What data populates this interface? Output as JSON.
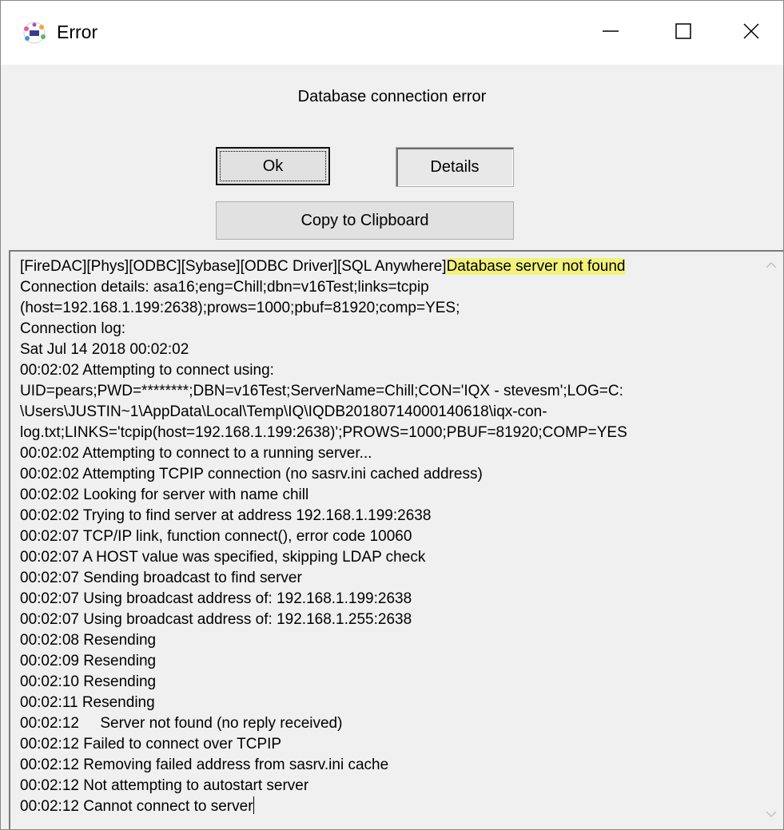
{
  "window": {
    "title": "Error",
    "icon": "iqx-app-icon"
  },
  "titlebar_buttons": {
    "minimize_icon": "minimize-icon",
    "maximize_icon": "maximize-icon",
    "close_icon": "close-icon"
  },
  "dialog": {
    "message": "Database connection error",
    "ok_label": "Ok",
    "details_label": "Details",
    "copy_label": "Copy to Clipboard"
  },
  "details": {
    "first_line_prefix": "[FireDAC][Phys][ODBC][Sybase][ODBC Driver][SQL Anywhere]",
    "first_line_highlight": "Database server not found",
    "highlight_color": "#f2f27a",
    "lines": [
      "Connection details: asa16;eng=Chill;dbn=v16Test;links=tcpip",
      "(host=192.168.1.199:2638);prows=1000;pbuf=81920;comp=YES;",
      "Connection log:",
      "Sat Jul 14 2018 00:02:02",
      "00:02:02 Attempting to connect using:",
      "UID=pears;PWD=********;DBN=v16Test;ServerName=Chill;CON='IQX - stevesm';LOG=C:",
      "\\Users\\JUSTIN~1\\AppData\\Local\\Temp\\IQ\\IQDB20180714000140618\\iqx-con-",
      "log.txt;LINKS='tcpip(host=192.168.1.199:2638)';PROWS=1000;PBUF=81920;COMP=YES",
      "00:02:02 Attempting to connect to a running server...",
      "00:02:02 Attempting TCPIP connection (no sasrv.ini cached address)",
      "00:02:02 Looking for server with name chill",
      "00:02:02 Trying to find server at address 192.168.1.199:2638",
      "00:02:07 TCP/IP link, function connect(), error code 10060",
      "00:02:07 A HOST value was specified, skipping LDAP check",
      "00:02:07 Sending broadcast to find server",
      "00:02:07 Using broadcast address of: 192.168.1.199:2638",
      "00:02:07 Using broadcast address of: 192.168.1.255:2638",
      "00:02:08 Resending",
      "00:02:09 Resending",
      "00:02:10 Resending",
      "00:02:11 Resending",
      "00:02:12     Server not found (no reply received)",
      "00:02:12 Failed to connect over TCPIP",
      "00:02:12 Removing failed address from sasrv.ini cache",
      "00:02:12 Not attempting to autostart server",
      "00:02:12 Cannot connect to server"
    ]
  },
  "scrollbar": {
    "up_icon": "chevron-up-icon",
    "down_icon": "chevron-down-icon"
  }
}
